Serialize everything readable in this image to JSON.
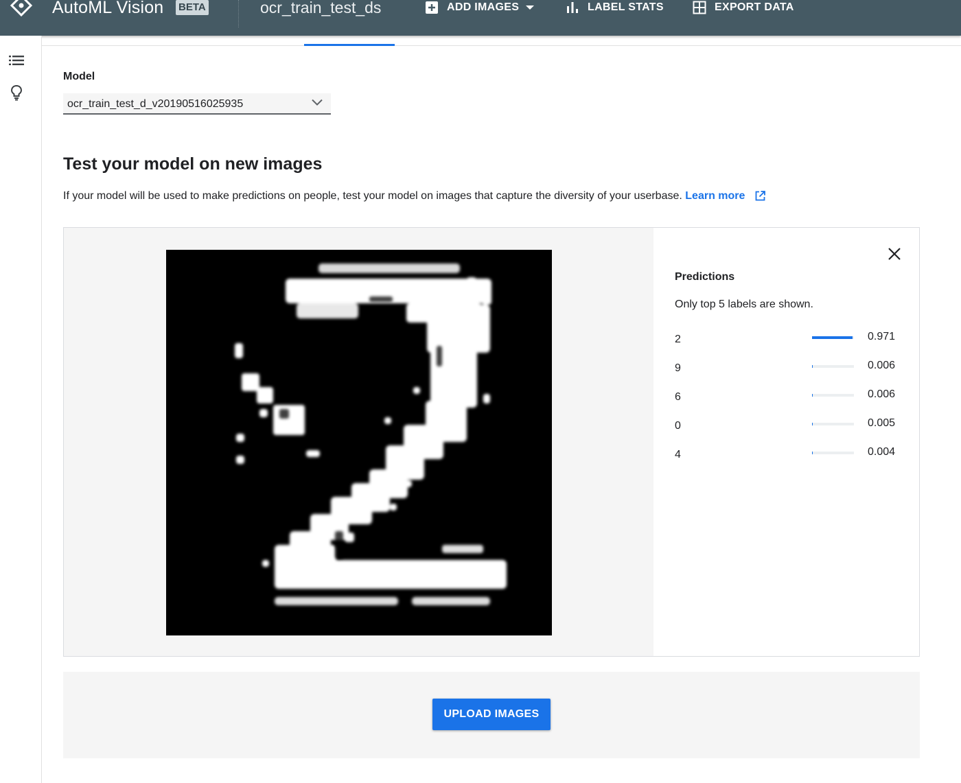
{
  "header": {
    "app_title": "AutoML Vision",
    "badge": "BETA",
    "dataset_title": "ocr_train_test_ds",
    "actions": [
      {
        "label": "ADD IMAGES",
        "icon": "add-box-icon"
      },
      {
        "label": "LABEL STATS",
        "icon": "bar-chart-icon"
      },
      {
        "label": "EXPORT DATA",
        "icon": "grid-icon"
      }
    ]
  },
  "sidebar": {
    "icons": [
      "list-icon",
      "lightbulb-icon"
    ]
  },
  "model": {
    "label": "Model",
    "selected": "ocr_train_test_d_v20190516025935"
  },
  "test_section": {
    "heading": "Test your model on new images",
    "description": "If your model will be used to make predictions on people, test your model on images that capture the diversity of your userbase.",
    "learn_more": "Learn more"
  },
  "predictions": {
    "title": "Predictions",
    "subtitle": "Only top 5 labels are shown.",
    "items": [
      {
        "label": "2",
        "score": "0.971",
        "value": 0.971
      },
      {
        "label": "9",
        "score": "0.006",
        "value": 0.006
      },
      {
        "label": "6",
        "score": "0.006",
        "value": 0.006
      },
      {
        "label": "0",
        "score": "0.005",
        "value": 0.005
      },
      {
        "label": "4",
        "score": "0.004",
        "value": 0.004
      }
    ]
  },
  "upload": {
    "button_label": "UPLOAD IMAGES"
  },
  "colors": {
    "header_bg": "#455a64",
    "accent": "#1a73e8"
  }
}
